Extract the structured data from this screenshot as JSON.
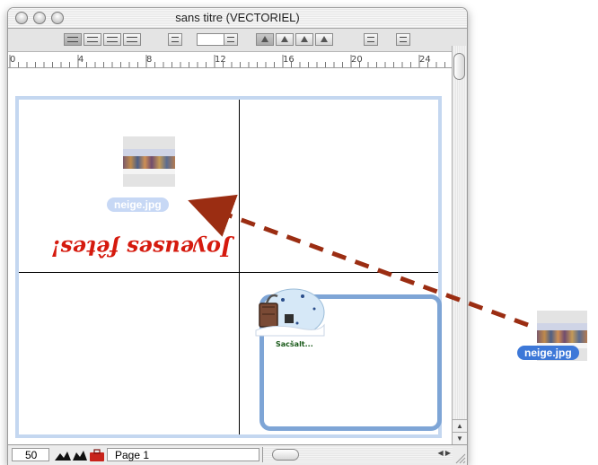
{
  "window": {
    "title": "sans titre (VECTORIEL)"
  },
  "ruler": {
    "labels": [
      "0",
      "4",
      "8",
      "12",
      "16",
      "20",
      "24"
    ]
  },
  "document": {
    "image_file": "neige.jpg",
    "greeting_text": "Joyeuses fêtes!",
    "clipart_caption": "Sacšalt..."
  },
  "statusbar": {
    "zoom": "50",
    "page": "Page 1"
  },
  "dragged_file": {
    "name": "neige.jpg"
  },
  "colors": {
    "greeting": "#d51a0e",
    "page_frame": "#c4d7f0",
    "card_frame": "#7ea5d6",
    "label_dark": "#3d78d8",
    "drag_arrow": "#9b2d12"
  }
}
